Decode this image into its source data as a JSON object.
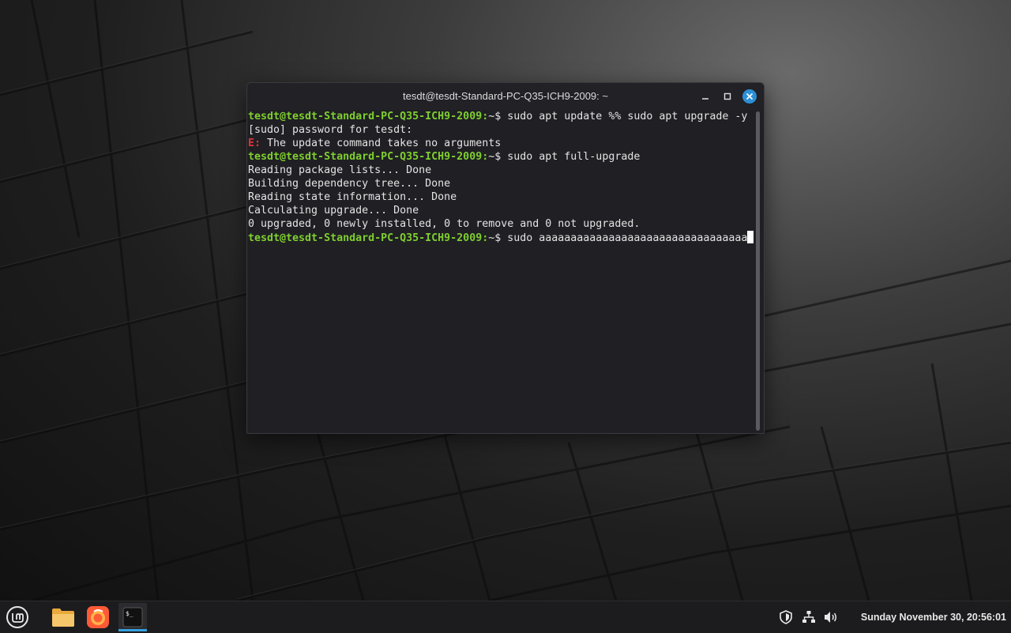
{
  "window": {
    "title": "tesdt@tesdt-Standard-PC-Q35-ICH9-2009: ~"
  },
  "terminal": {
    "lines": [
      {
        "prompt": "tesdt@tesdt-Standard-PC-Q35-ICH9-2009:",
        "text": "~$ sudo apt update %% sudo apt upgrade -y"
      },
      {
        "text": "[sudo] password for tesdt:"
      },
      {
        "error": "E:",
        "text": " The update command takes no arguments"
      },
      {
        "prompt": "tesdt@tesdt-Standard-PC-Q35-ICH9-2009:",
        "text": "~$ sudo apt full-upgrade"
      },
      {
        "text": "Reading package lists... Done"
      },
      {
        "text": "Building dependency tree... Done"
      },
      {
        "text": "Reading state information... Done"
      },
      {
        "text": "Calculating upgrade... Done"
      },
      {
        "text": "0 upgraded, 0 newly installed, 0 to remove and 0 not upgraded."
      },
      {
        "prompt": "tesdt@tesdt-Standard-PC-Q35-ICH9-2009:",
        "text": "~$ sudo aaaaaaaaaaaaaaaaaaaaaaaaaaaaaaaaa",
        "cursor": true
      }
    ]
  },
  "taskbar": {
    "clock": "Sunday November 30, 20:56:01",
    "apps": [
      "mint-menu-icon",
      "files-folder-icon",
      "firefox-icon",
      "terminal-icon"
    ],
    "tray": [
      "shield-icon",
      "network-icon",
      "volume-icon"
    ]
  },
  "colors": {
    "prompt": "#7fcf2e",
    "error": "#e2333a",
    "accent": "#35a0e0",
    "terminal_bg": "#1f1f24"
  }
}
